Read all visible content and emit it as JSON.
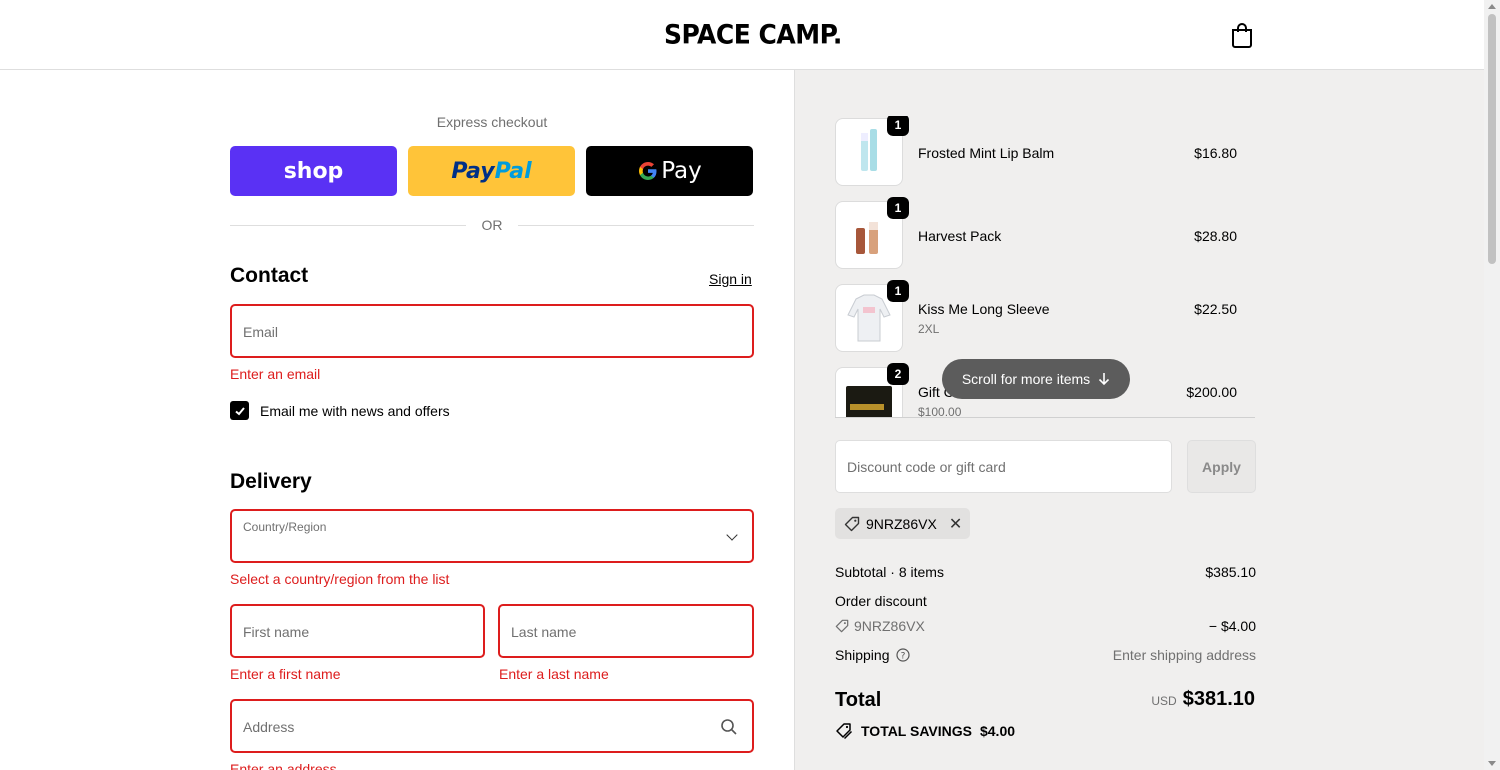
{
  "header": {
    "logo_text": "SPACE CAMP.",
    "cart_icon": "shopping-bag-icon"
  },
  "express": {
    "label": "Express checkout",
    "shop_label": "shop",
    "paypal_pay": "Pay",
    "paypal_pal": "Pal",
    "gpay_g": "G",
    "gpay_label": "Pay",
    "or_label": "OR"
  },
  "contact": {
    "title": "Contact",
    "signin_label": "Sign in",
    "email_placeholder": "Email",
    "email_error": "Enter an email",
    "newsletter_label": "Email me with news and offers",
    "newsletter_checked": true
  },
  "delivery": {
    "title": "Delivery",
    "country_label": "Country/Region",
    "country_error": "Select a country/region from the list",
    "first_name_placeholder": "First name",
    "first_name_error": "Enter a first name",
    "last_name_placeholder": "Last name",
    "last_name_error": "Enter a last name",
    "address_placeholder": "Address",
    "address_error": "Enter an address"
  },
  "cart": {
    "items": [
      {
        "qty": "1",
        "name": "Frosted Mint Lip Balm",
        "variant": "",
        "price": "$16.80"
      },
      {
        "qty": "1",
        "name": "Harvest Pack",
        "variant": "",
        "price": "$28.80"
      },
      {
        "qty": "1",
        "name": "Kiss Me Long Sleeve",
        "variant": "2XL",
        "price": "$22.50"
      },
      {
        "qty": "2",
        "name": "Gift C",
        "variant": "$100.00",
        "price": "$200.00"
      }
    ],
    "scroll_hint": "Scroll for more items"
  },
  "discount": {
    "placeholder": "Discount code or gift card",
    "apply_label": "Apply",
    "applied_code": "9NRZ86VX"
  },
  "summary": {
    "subtotal_label": "Subtotal · 8 items",
    "subtotal_value": "$385.10",
    "order_discount_label": "Order discount",
    "order_discount_code": "9NRZ86VX",
    "order_discount_value": "− $4.00",
    "shipping_label": "Shipping",
    "shipping_value": "Enter shipping address",
    "total_label": "Total",
    "total_currency": "USD",
    "total_value": "$381.10",
    "savings_label": "TOTAL SAVINGS",
    "savings_value": "$4.00"
  },
  "colors": {
    "error": "#dd1d1d",
    "shop_purple": "#5a31f4",
    "paypal_yellow": "#ffc439",
    "summary_bg": "#f0efee"
  }
}
